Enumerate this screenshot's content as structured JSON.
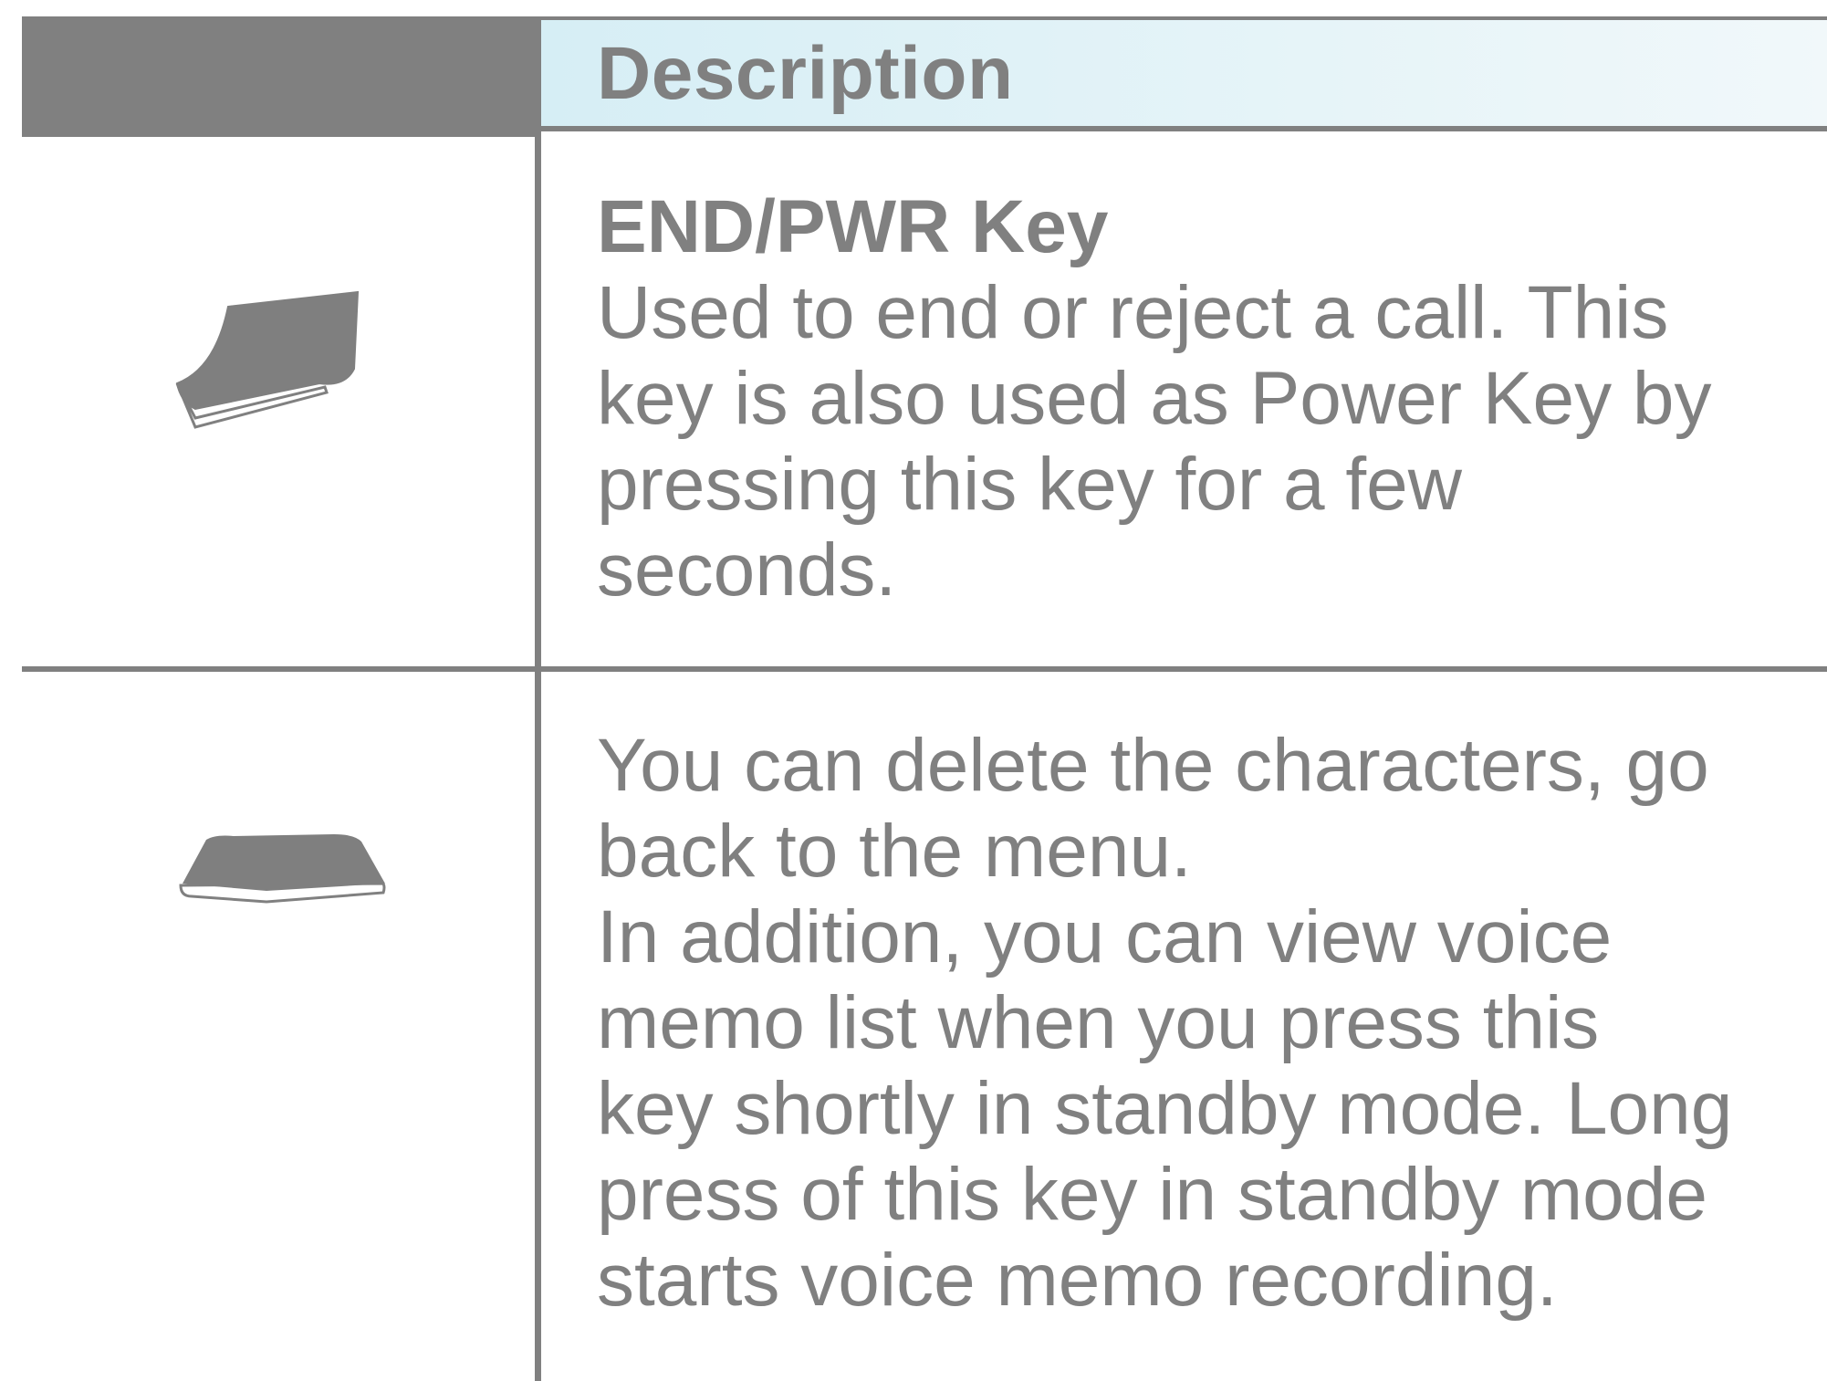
{
  "header": {
    "description_label": "Description"
  },
  "rows": [
    {
      "icon": "end-power-key-icon",
      "title": "END/PWR Key",
      "lines": [
        "Used to end or reject a call. This",
        "key is also used as Power Key by",
        "pressing this key for a few",
        "seconds."
      ]
    },
    {
      "icon": "clear-key-icon",
      "lines": [
        "You can delete the characters, go",
        "back to the menu.",
        "In addition, you can view voice",
        "memo list when you press this",
        "key shortly in standby mode. Long",
        "press of this key in standby mode",
        "starts voice memo recording."
      ]
    }
  ],
  "colors": {
    "line": "#808080",
    "header_tint": "#d6eef5",
    "text": "#808080"
  }
}
